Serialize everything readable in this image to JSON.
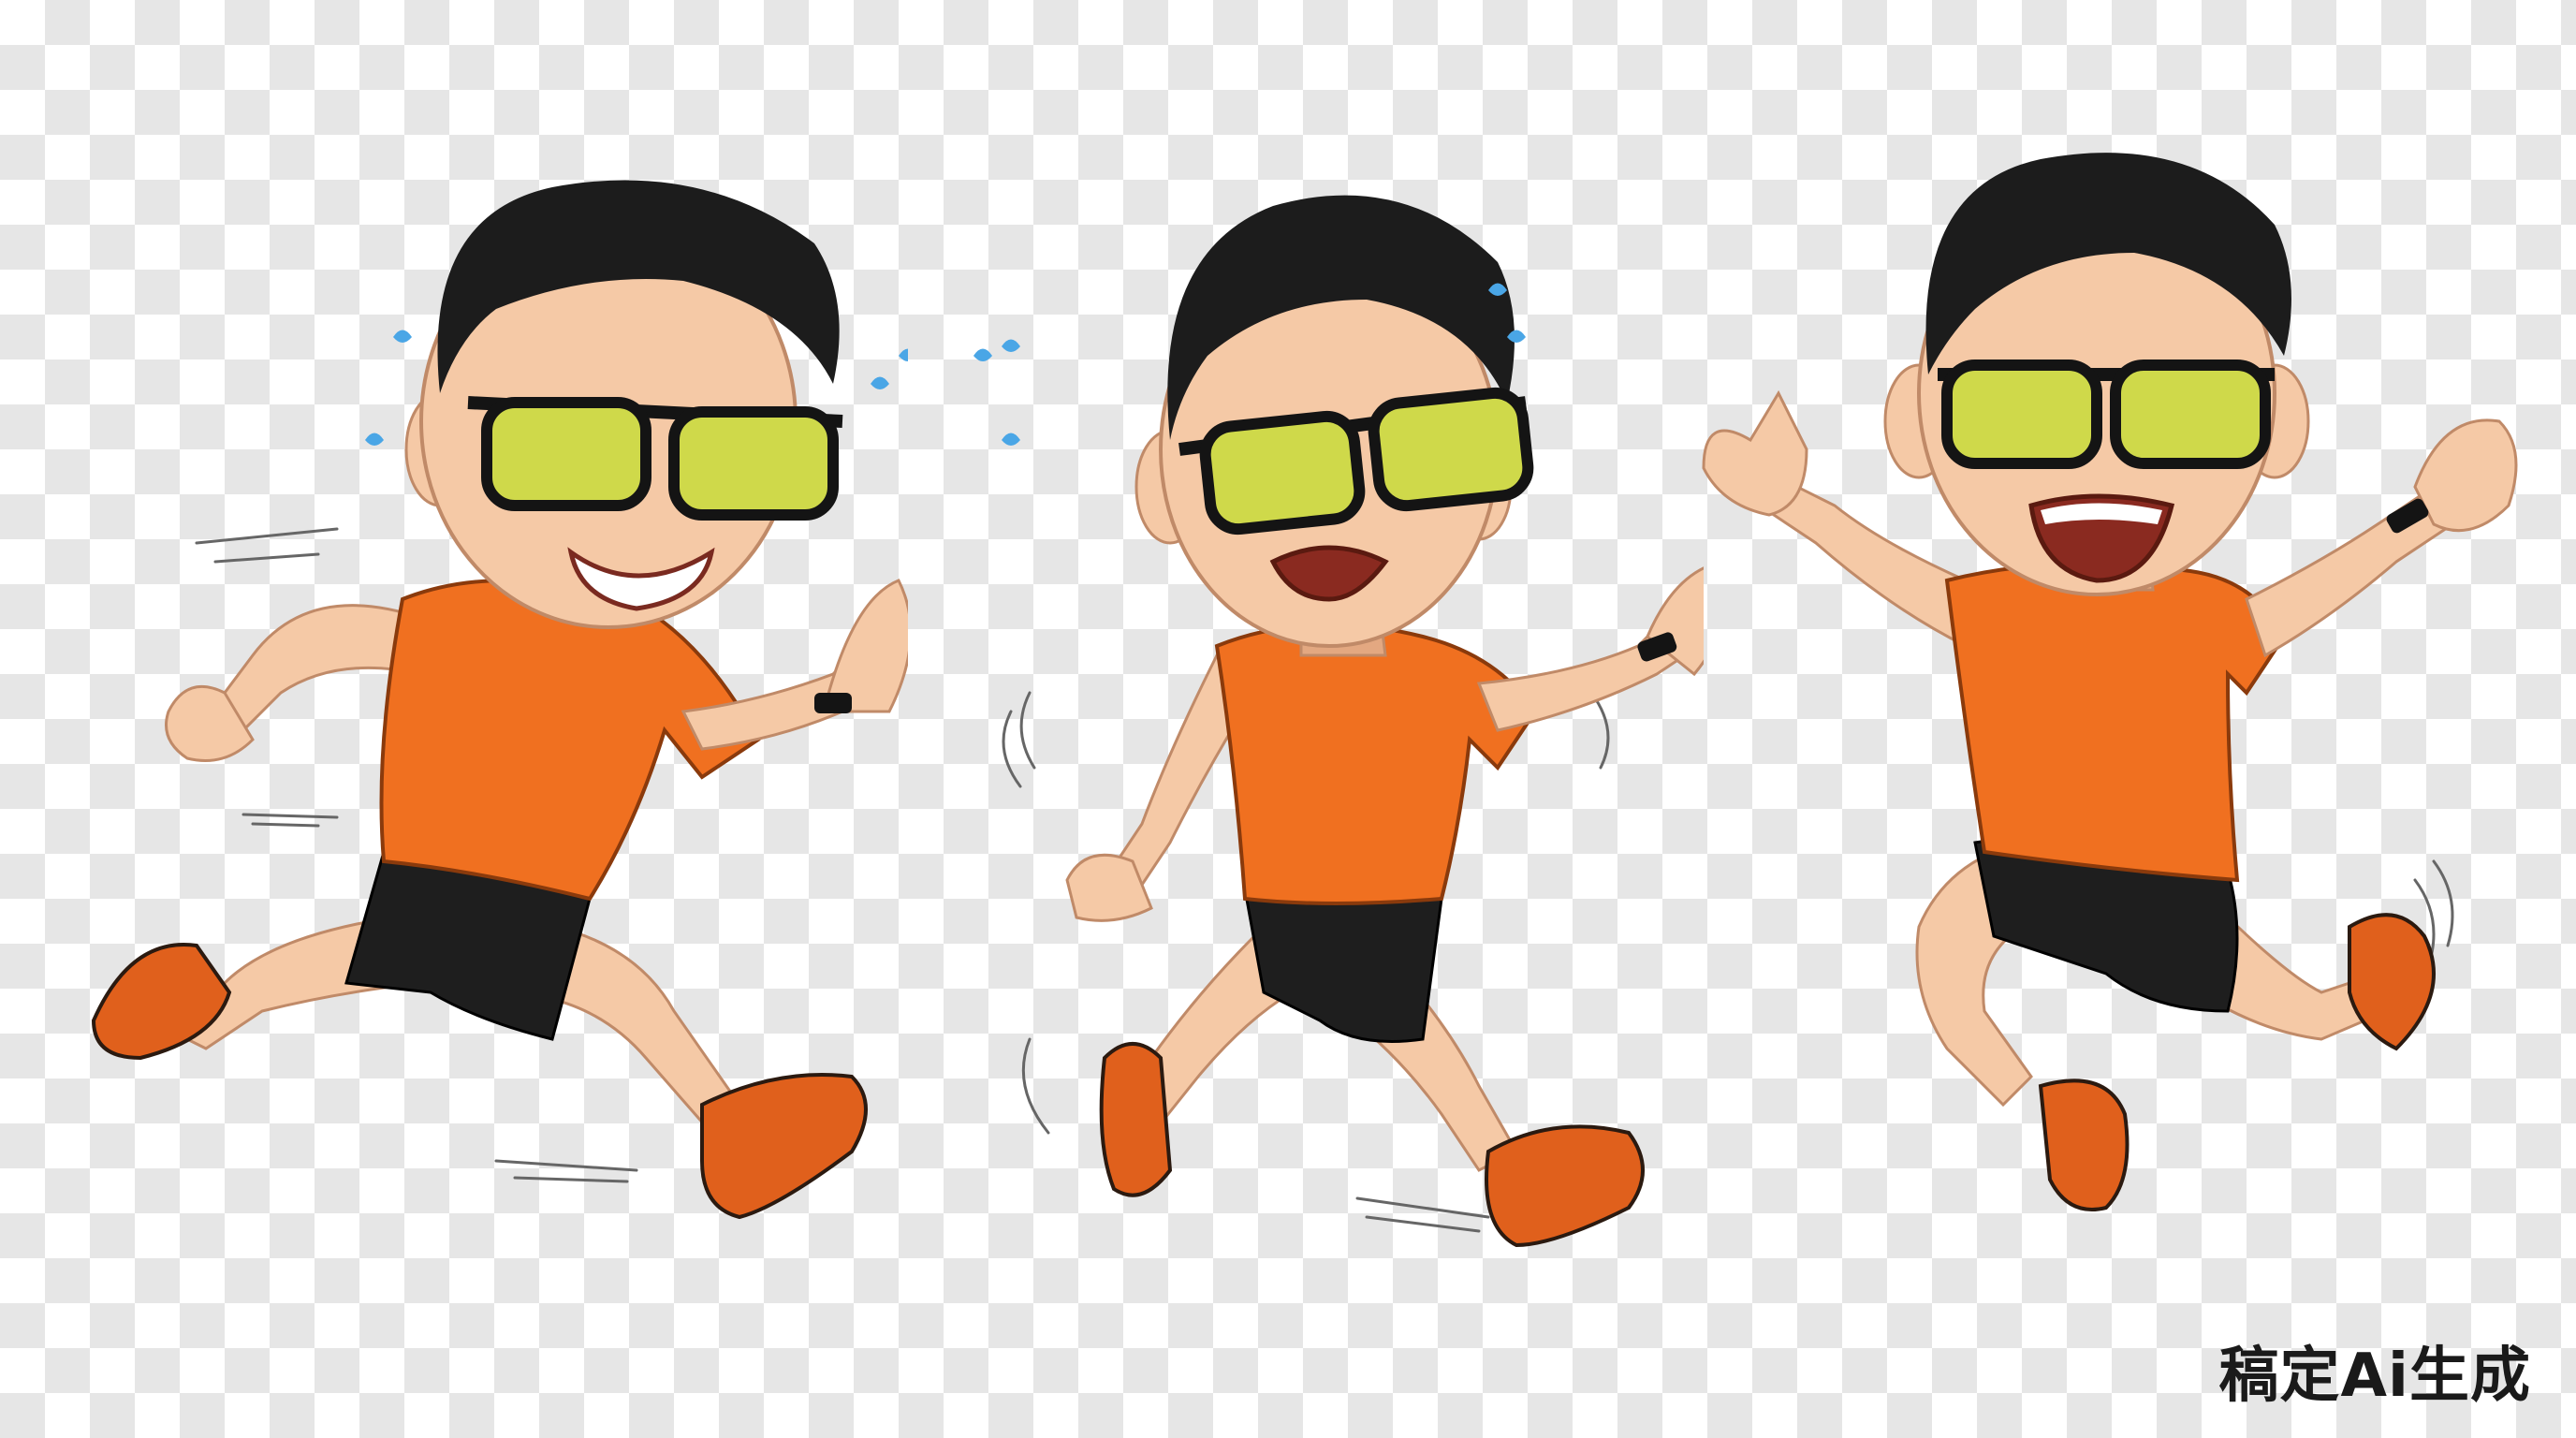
{
  "canvas": {
    "background": "transparency-checkerboard",
    "check_colors": [
      "#ffffff",
      "#e6e6e6"
    ]
  },
  "figures": [
    {
      "pose": "running-smiling",
      "expression": "grinning"
    },
    {
      "pose": "running-exhausted",
      "expression": "distressed"
    },
    {
      "pose": "jumping-celebrating",
      "expression": "laughing"
    }
  ],
  "colors": {
    "shirt": "#f07020",
    "shirt_shadow": "#c9561a",
    "shorts": "#1e1e1e",
    "skin": "#f5c9a6",
    "skin_shadow": "#e3a881",
    "hair": "#1c1c1c",
    "lens": "#cfd94a",
    "frame": "#141414",
    "shoe": "#e0601c",
    "sweat": "#4aa6e6"
  },
  "watermark": {
    "text": "稿定Ai生成"
  }
}
